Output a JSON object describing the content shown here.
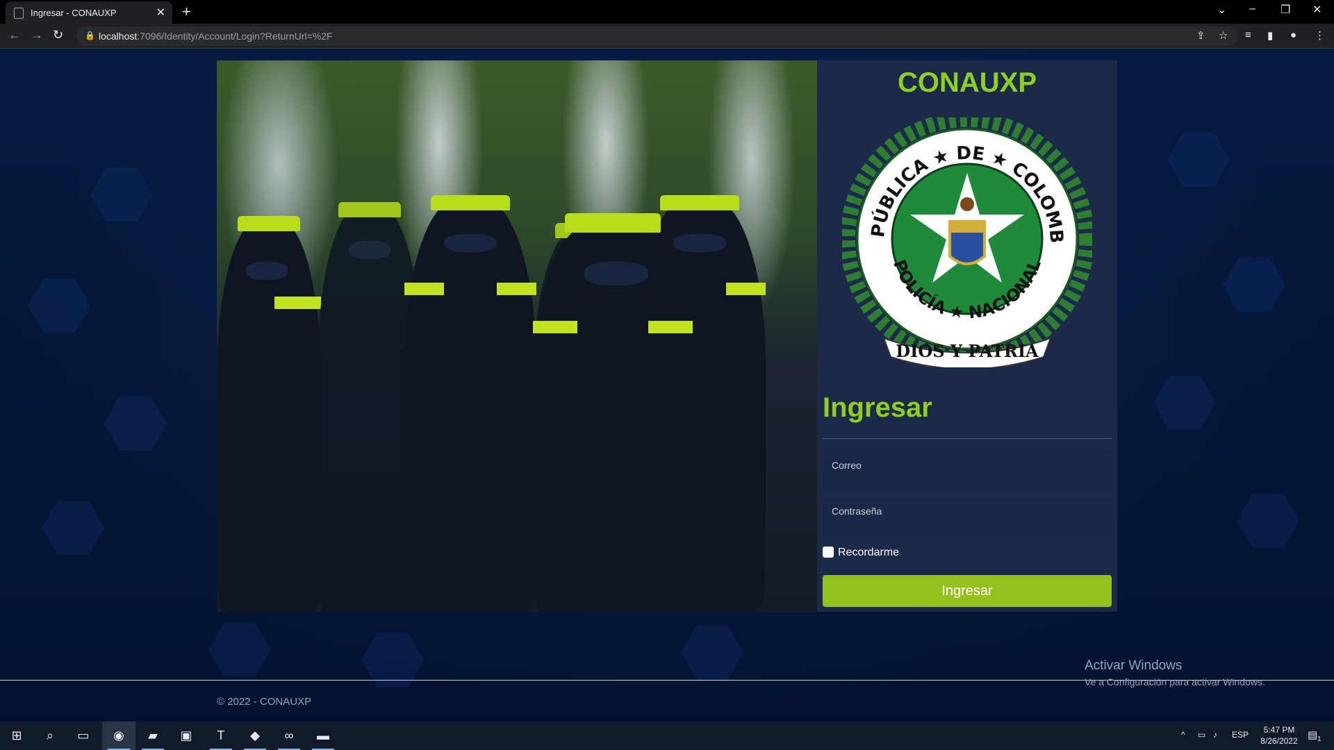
{
  "browser": {
    "tab_title": "Ingresar - CONAUXP",
    "tab_close": "✕",
    "new_tab": "+",
    "url_host": "localhost",
    "url_rest": ":7096/Identity/Account/Login?ReturnUrl=%2F"
  },
  "login": {
    "brand": "CONAUXP",
    "heading": "Ingresar",
    "email_label": "Correo",
    "password_label": "Contraseña",
    "remember_label": "Recordarme",
    "submit_label": "Ingresar"
  },
  "seal": {
    "top_text": "REPÚBLICA ★ DE ★ COLOMBIA",
    "bottom_text": "POLICÍA ★ NACIONAL",
    "motto": "DIOS Y PATRIA"
  },
  "footer": {
    "copyright": "© 2022 - CONAUXP"
  },
  "watermark": {
    "title": "Activar Windows",
    "subtitle": "Ve a Configuración para activar Windows."
  },
  "taskbar": {
    "language": "ESP",
    "time": "5:47 PM",
    "date": "8/26/2022",
    "notification_count": "1"
  },
  "colors": {
    "accent_green": "#95c11f",
    "heading_green": "#8fcf21",
    "panel_bg": "#1c2a4a",
    "page_bg": "#041637"
  },
  "icons": [
    "back-icon",
    "forward-icon",
    "reload-icon",
    "lock-icon",
    "share-icon",
    "star-icon",
    "media-icon",
    "sidepanel-icon",
    "profile-icon",
    "menu-icon",
    "windows-start-icon",
    "search-icon",
    "task-view-icon",
    "chrome-icon",
    "file-explorer-icon",
    "store-icon",
    "teams-icon",
    "vscode-icon",
    "visual-studio-icon",
    "terminal-icon"
  ]
}
